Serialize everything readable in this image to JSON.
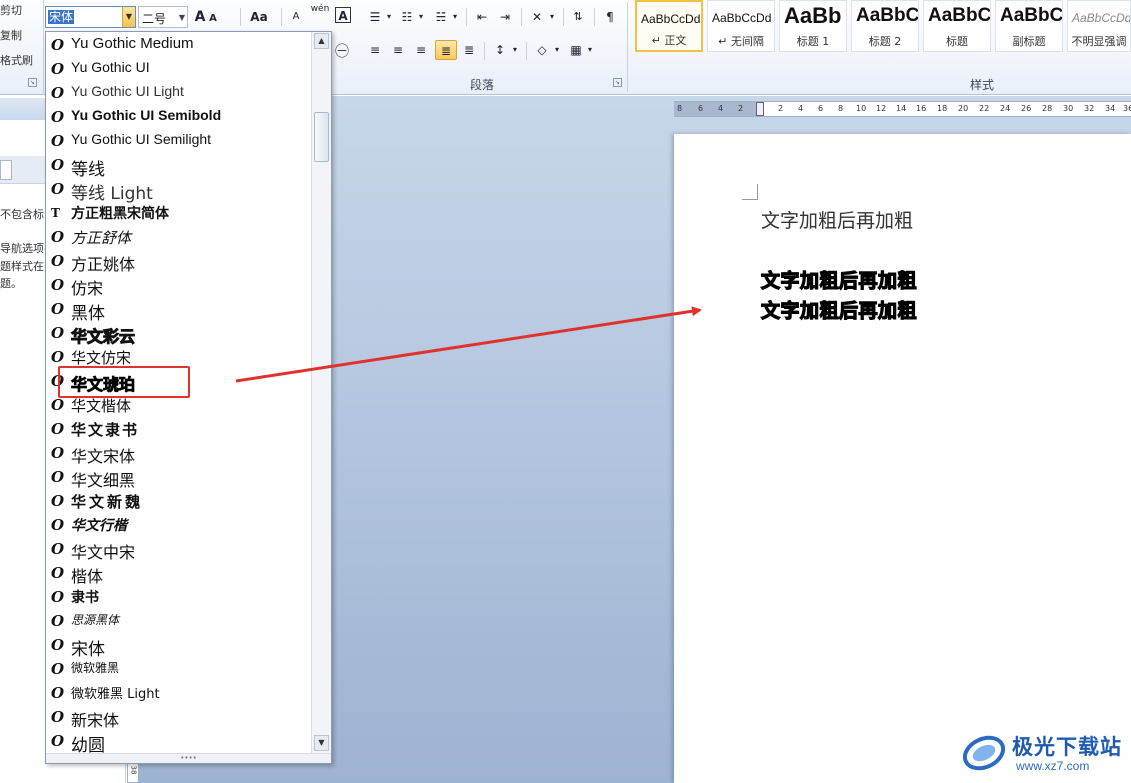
{
  "clipboard": {
    "cut_label": "剪切",
    "copy_label": "复制",
    "format_painter_label": "格式刷"
  },
  "font_toolbar": {
    "font_name": "宋体",
    "font_size": "二号",
    "grow_label": "A",
    "shrink_label": "A",
    "case_label": "Aa",
    "clear_format_label": "A",
    "phonetic_label": "wén",
    "border_label": "A"
  },
  "paragraph": {
    "group_label": "段落"
  },
  "styles": {
    "group_label": "样式",
    "items": [
      {
        "sample": "AaBbCcDd",
        "name": "↵ 正文"
      },
      {
        "sample": "AaBbCcDd",
        "name": "↵ 无间隔"
      },
      {
        "sample": "AaBb",
        "name": "标题 1"
      },
      {
        "sample": "AaBbC",
        "name": "标题 2"
      },
      {
        "sample": "AaBbC",
        "name": "标题"
      },
      {
        "sample": "AaBbC",
        "name": "副标题"
      },
      {
        "sample": "AaBbCcDd",
        "name": "不明显强调"
      }
    ]
  },
  "nav_pane": {
    "line1": "不包含标",
    "line2": "导航选项-",
    "line3": "题样式在",
    "line4": "题。"
  },
  "ruler": {
    "ticks": [
      "8",
      "6",
      "4",
      "2",
      "",
      "2",
      "4",
      "6",
      "8",
      "10",
      "12",
      "14",
      "16",
      "18",
      "20",
      "22",
      "24",
      "26",
      "28",
      "30",
      "32",
      "34",
      "36"
    ]
  },
  "vertical_ruler_label": "38",
  "font_list": [
    "Yu Gothic Medium",
    "Yu Gothic UI",
    "Yu Gothic UI Light",
    "Yu Gothic UI Semibold",
    "Yu Gothic UI Semilight",
    "等线",
    "等线 Light",
    "方正粗黑宋简体",
    "方正舒体",
    "方正姚体",
    "仿宋",
    "黑体",
    "华文彩云",
    "华文仿宋",
    "华文琥珀",
    "华文楷体",
    "华文隶书",
    "华文宋体",
    "华文细黑",
    "华文新魏",
    "华文行楷",
    "华文中宋",
    "楷体",
    "隶书",
    "思源黑体",
    "宋体",
    "微软雅黑",
    "微软雅黑 Light",
    "新宋体",
    "幼圆"
  ],
  "font_icons": {
    "truetype": "O",
    "opentype": "T"
  },
  "highlighted_font": "华文琥珀",
  "document": {
    "line1": "文字加粗后再加粗",
    "line2": "文字加粗后再加粗",
    "line3": "文字加粗后再加粗"
  },
  "watermark": {
    "name": "极光下载站",
    "url": "www.xz7.com"
  },
  "colors": {
    "accent": "#3b73c7",
    "annotation": "#e0322c",
    "workspace": "#a9bdd9"
  }
}
